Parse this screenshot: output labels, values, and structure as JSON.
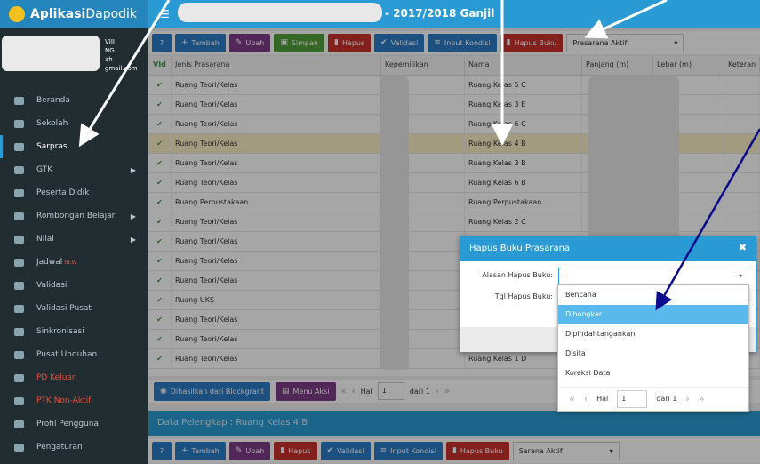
{
  "app": {
    "brand_bold": "Aplikasi",
    "brand_light": "Dapodik",
    "period": "- 2017/2018 Ganjil"
  },
  "profile": {
    "line1": "VIII",
    "line2": "NG",
    "line3": "ah",
    "line4": "gmail.com"
  },
  "sidebar": {
    "items": [
      {
        "label": "Beranda",
        "icon": "monitor-icon"
      },
      {
        "label": "Sekolah",
        "icon": "school-icon"
      },
      {
        "label": "Sarpras",
        "icon": "building-icon",
        "active": true
      },
      {
        "label": "GTK",
        "icon": "graduation-cap-icon",
        "arrow": true
      },
      {
        "label": "Peserta Didik",
        "icon": "smile-icon"
      },
      {
        "label": "Rombongan Belajar",
        "icon": "group-icon",
        "arrow": true
      },
      {
        "label": "Nilai",
        "icon": "list-icon",
        "arrow": true
      },
      {
        "label": "Jadwal",
        "icon": "people-icon",
        "badge": "NEW"
      },
      {
        "label": "Validasi",
        "icon": "check-icon"
      },
      {
        "label": "Validasi Pusat",
        "icon": "refresh-icon"
      },
      {
        "label": "Sinkronisasi",
        "icon": "sync-icon"
      },
      {
        "label": "Pusat Unduhan",
        "icon": "download-icon"
      },
      {
        "label": "PD Keluar",
        "icon": "exit-icon",
        "red": true
      },
      {
        "label": "PTK Non-Aktif",
        "icon": "user-off-icon",
        "red": true
      },
      {
        "label": "Profil Pengguna",
        "icon": "user-icon"
      },
      {
        "label": "Pengaturan",
        "icon": "gear-icon"
      }
    ]
  },
  "toolbar": {
    "tambah": "Tambah",
    "ubah": "Ubah",
    "simpan": "Simpan",
    "hapus": "Hapus",
    "validasi": "Validasi",
    "input_kondisi": "Input Kondisi",
    "hapus_buku": "Hapus Buku",
    "filter": "Prasarana Aktif"
  },
  "grid": {
    "columns": [
      "Vld",
      "Jenis Prasarana",
      "Kepemilikan",
      "Nama",
      "Panjang (m)",
      "Lebar (m)",
      "Keteran"
    ],
    "rows": [
      {
        "jenis": "Ruang Teori/Kelas",
        "nama": "Ruang Kelas 5 C"
      },
      {
        "jenis": "Ruang Teori/Kelas",
        "nama": "Ruang Kelas 3 E"
      },
      {
        "jenis": "Ruang Teori/Kelas",
        "nama": "Ruang Kelas 6 C"
      },
      {
        "jenis": "Ruang Teori/Kelas",
        "nama": "Ruang Kelas 4 B",
        "selected": true
      },
      {
        "jenis": "Ruang Teori/Kelas",
        "nama": "Ruang Kelas 3 B"
      },
      {
        "jenis": "Ruang Teori/Kelas",
        "nama": "Ruang Kelas 6 B"
      },
      {
        "jenis": "Ruang Perpustakaan",
        "nama": "Ruang Perpustakaan"
      },
      {
        "jenis": "Ruang Teori/Kelas",
        "nama": "Ruang Kelas 2 C"
      },
      {
        "jenis": "Ruang Teori/Kelas",
        "nama": ""
      },
      {
        "jenis": "Ruang Teori/Kelas",
        "nama": ""
      },
      {
        "jenis": "Ruang Teori/Kelas",
        "nama": ""
      },
      {
        "jenis": "Ruang UKS",
        "nama": ""
      },
      {
        "jenis": "Ruang Teori/Kelas",
        "nama": ""
      },
      {
        "jenis": "Ruang Teori/Kelas",
        "nama": ""
      },
      {
        "jenis": "Ruang Teori/Kelas",
        "nama": "Ruang Kelas 1 D"
      }
    ],
    "check": "✔"
  },
  "pager": {
    "export": "Dihasilkan dari Blockgrant",
    "menu": "Menu Aksi",
    "hal": "Hal",
    "page": "1",
    "of": "dari 1"
  },
  "detail": {
    "title": "Data Pelengkap : Ruang Kelas 4 B",
    "filter": "Sarana Aktif",
    "hapus_buku": "Hapus Buku"
  },
  "dialog": {
    "title": "Hapus Buku Prasarana",
    "alasan_label": "Alasan Hapus Buku:",
    "tgl_label": "Tgl Hapus Buku:",
    "options": [
      "Bencana",
      "Dibongkar",
      "Dipindahtangankan",
      "Disita",
      "Koreksi Data"
    ],
    "highlighted": "Dibongkar",
    "hal": "Hal",
    "page": "1",
    "of": "dari 1"
  }
}
